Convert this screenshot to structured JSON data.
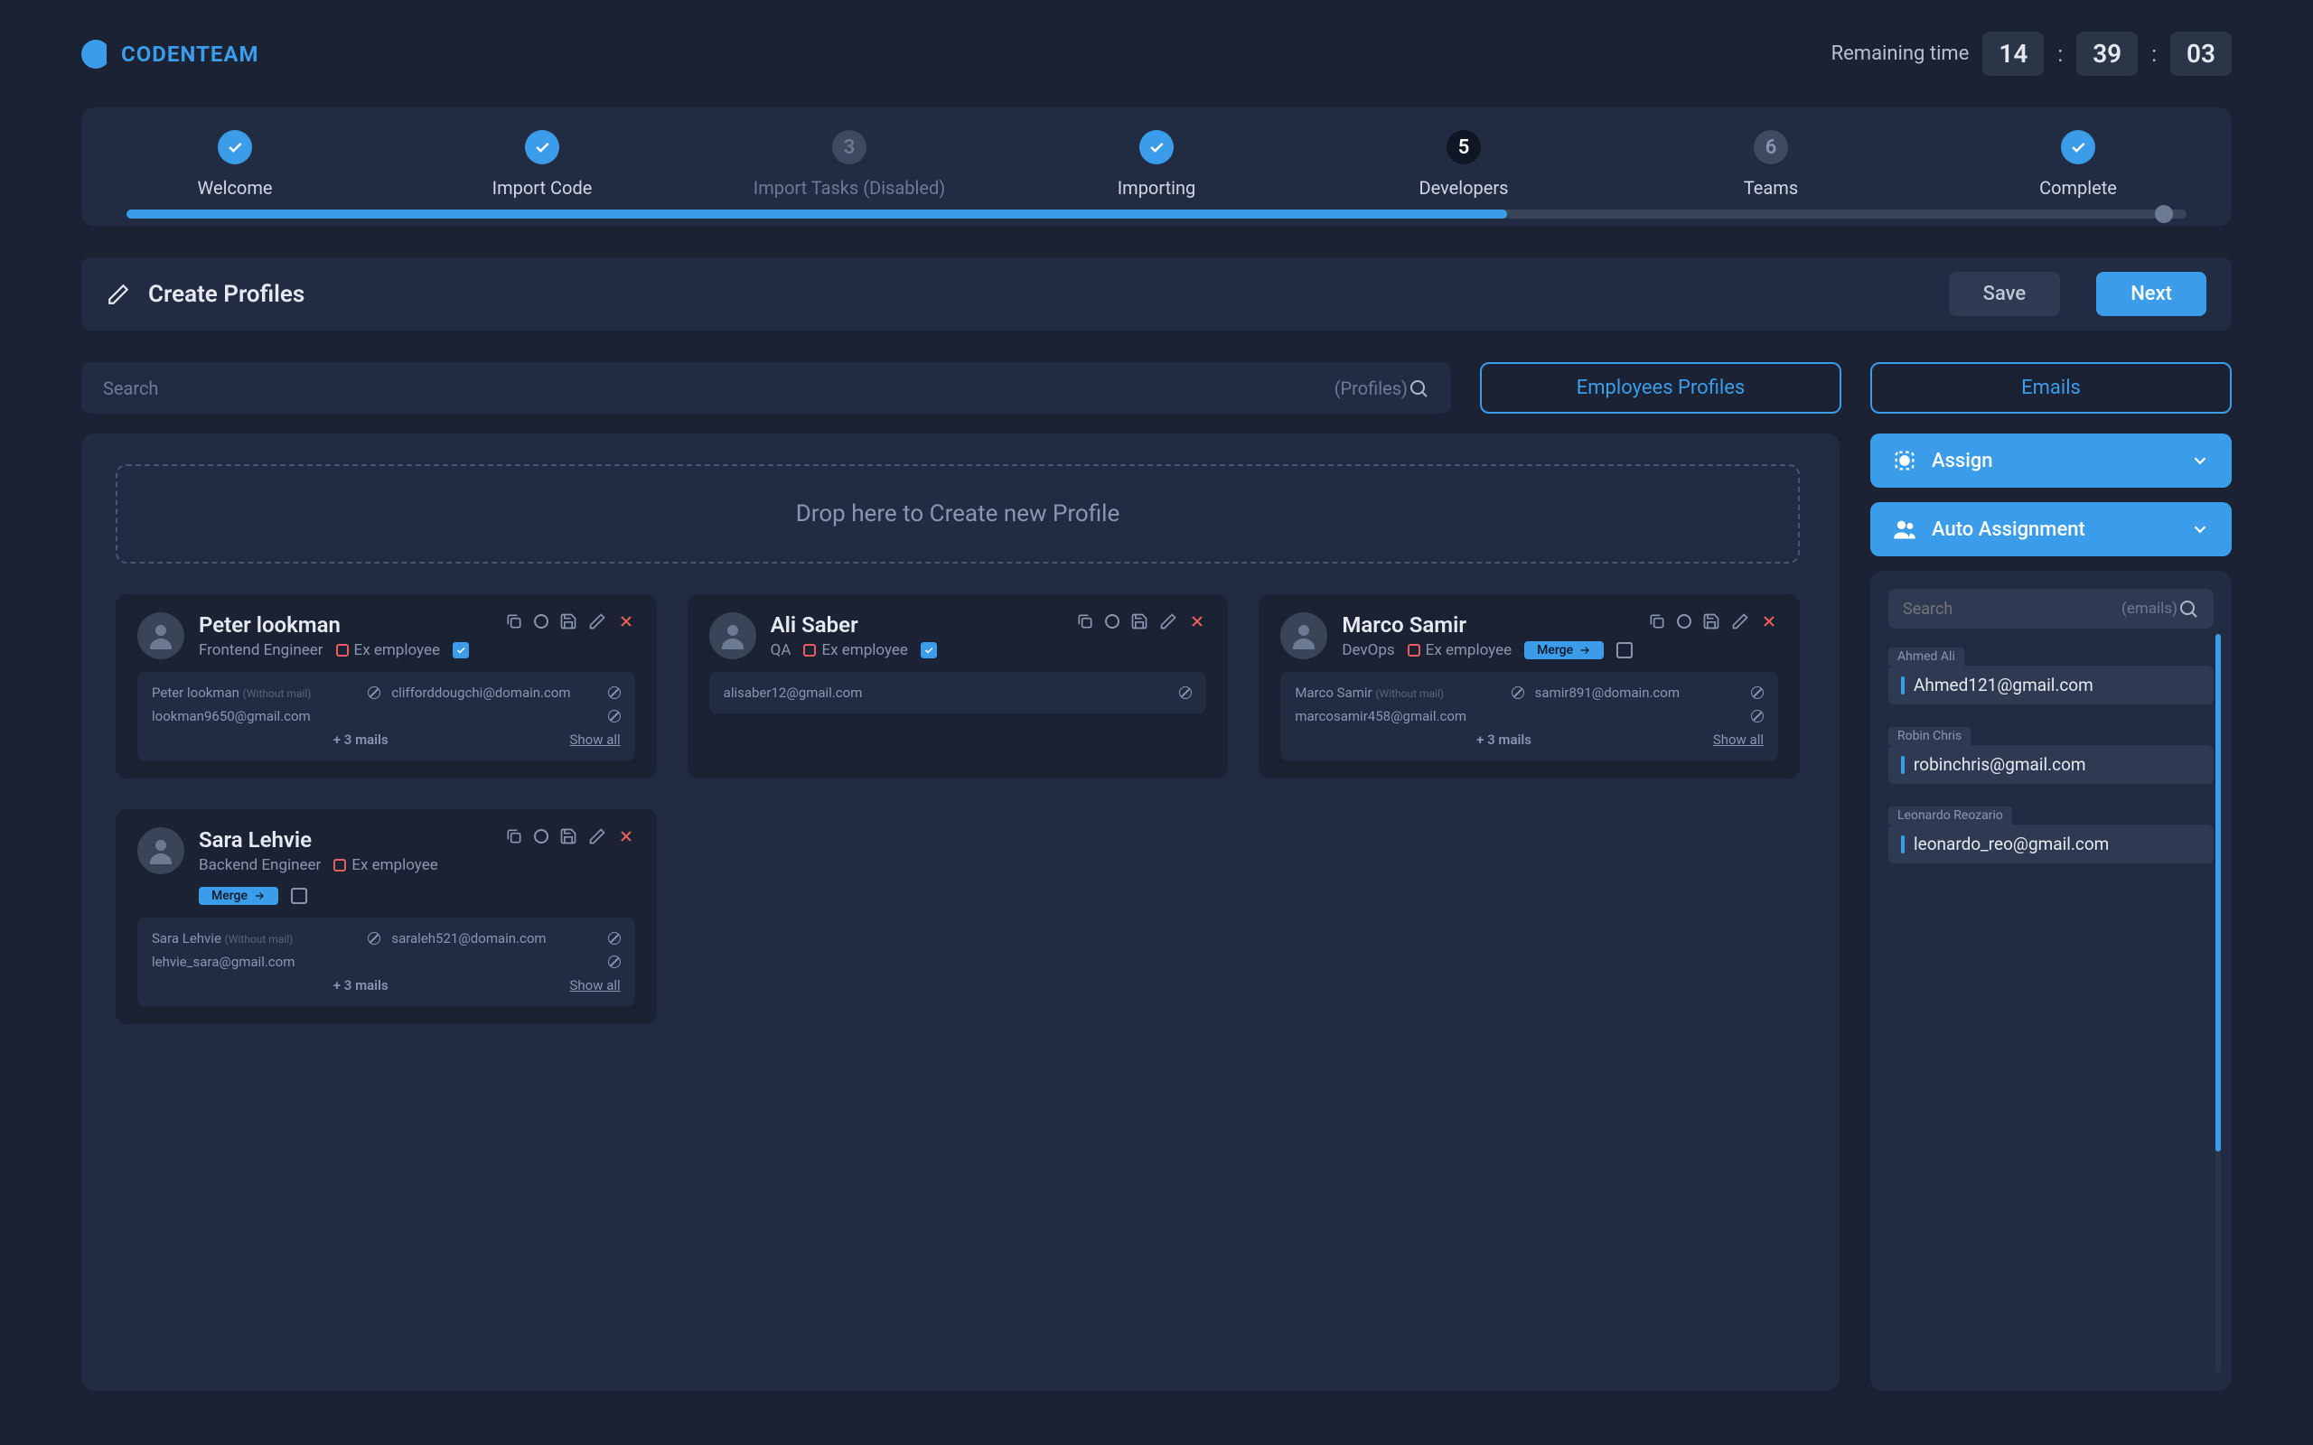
{
  "brand": "CODENTEAM",
  "timer": {
    "label": "Remaining time",
    "hh": "14",
    "mm": "39",
    "ss": "03"
  },
  "steps": [
    {
      "label": "Welcome",
      "state": "done"
    },
    {
      "label": "Import Code",
      "state": "done"
    },
    {
      "label": "Import Tasks (Disabled)",
      "state": "disabled",
      "num": "3"
    },
    {
      "label": "Importing",
      "state": "done"
    },
    {
      "label": "Developers",
      "state": "current",
      "num": "5"
    },
    {
      "label": "Teams",
      "state": "pending",
      "num": "6"
    },
    {
      "label": "Complete",
      "state": "done"
    }
  ],
  "titlebar": {
    "title": "Create Profiles",
    "save": "Save",
    "next": "Next"
  },
  "search": {
    "placeholder": "Search",
    "hint": "(Profiles)"
  },
  "tabs": {
    "employees": "Employees Profiles",
    "emails": "Emails"
  },
  "drop": "Drop here to Create new Profile",
  "exEmployee": "Ex employee",
  "moreMails": "+ 3 mails",
  "showAll": "Show all",
  "merge": "Merge",
  "profiles": [
    {
      "name": "Peter lookman",
      "role": "Frontend Engineer",
      "checked": true,
      "merge": false,
      "rows": [
        {
          "left": "Peter lookman",
          "leftNote": "(Without mail)",
          "right": "clifforddougchi@domain.com"
        },
        {
          "left": "lookman9650@gmail.com",
          "right": ""
        }
      ],
      "showMore": true
    },
    {
      "name": "Ali Saber",
      "role": "QA",
      "checked": true,
      "merge": false,
      "rows": [
        {
          "left": "alisaber12@gmail.com",
          "right": ""
        }
      ],
      "showMore": false
    },
    {
      "name": "Marco Samir",
      "role": "DevOps",
      "checked": false,
      "merge": true,
      "rows": [
        {
          "left": "Marco Samir",
          "leftNote": "(Without mail)",
          "right": "samir891@domain.com"
        },
        {
          "left": "marcosamir458@gmail.com",
          "right": ""
        }
      ],
      "showMore": true
    },
    {
      "name": "Sara Lehvie",
      "role": "Backend Engineer",
      "checked": false,
      "merge": true,
      "rows": [
        {
          "left": "Sara Lehvie",
          "leftNote": "(Without mail)",
          "right": "saraleh521@domain.com"
        },
        {
          "left": "lehvie_sara@gmail.com",
          "right": ""
        }
      ],
      "showMore": true
    }
  ],
  "sidebar": {
    "assign": "Assign",
    "auto": "Auto Assignment",
    "search": {
      "placeholder": "Search",
      "hint": "(emails)"
    },
    "emails": [
      {
        "name": "Ahmed Ali",
        "addr": "Ahmed121@gmail.com"
      },
      {
        "name": "Robin Chris",
        "addr": "robinchris@gmail.com"
      },
      {
        "name": "Leonardo Reozario",
        "addr": "leonardo_reo@gmail.com"
      }
    ]
  }
}
